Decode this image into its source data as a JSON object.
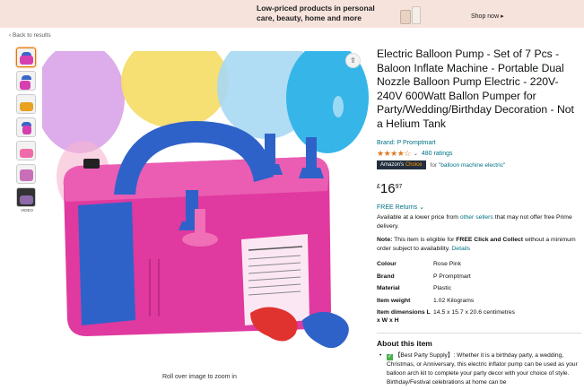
{
  "banner": {
    "text": "Low-priced products in personal care, beauty, home and more",
    "shop_now": "Shop now ▸"
  },
  "nav": {
    "back": "‹ Back to results"
  },
  "gallery": {
    "thumbnails": [
      "image-1",
      "image-2",
      "image-3",
      "image-4",
      "image-5",
      "image-6",
      "video"
    ],
    "video_label": "VIDEO",
    "rollover": "Roll over image to zoom in"
  },
  "product": {
    "title": "Electric Balloon Pump - Set of 7 Pcs - Baloon Inflate Machine - Portable Dual Nozzle Balloon Pump Electric - 220V-240V 600Watt Ballon Pumper for Party/Wedding/Birthday Decoration - Not a Helium Tank",
    "brand": "Brand: P Promptmart",
    "stars": "★★★★☆",
    "rating_value": 4.3,
    "ratings_count": "480 ratings",
    "choice_badge_main": "Amazon's",
    "choice_badge_accent": "Choice",
    "choice_for": "for",
    "choice_keyword": "\"balloon machine electric\"",
    "price_currency": "£",
    "price_whole": "16",
    "price_fraction": "97",
    "returns": "FREE Returns ⌄",
    "availability_pre": "Available at a lower price from ",
    "availability_link": "other sellers",
    "availability_post": " that may not offer free Prime delivery.",
    "note_label": "Note:",
    "note_pre": " This item is eligible for ",
    "note_bold": "FREE Click and Collect",
    "note_post": " without a minimum order subject to availability. ",
    "note_link": "Details",
    "specs": [
      {
        "key": "Colour",
        "value": "Rose Pink"
      },
      {
        "key": "Brand",
        "value": "P Promptmart"
      },
      {
        "key": "Material",
        "value": "Plastic"
      },
      {
        "key": "Item weight",
        "value": "1.02 Kilograms"
      },
      {
        "key": "Item dimensions L x W x H",
        "value": "14.5 x 15.7 x 20.6 centimetres"
      }
    ],
    "about_heading": "About this item",
    "about_bullet": "【Best Party Supply】: Whether it is a birthday party, a wedding, Christmas, or Anniversary, this electric inflator pump can be used as your balloon arch kit to complete your party decor with your choice of style. Birthday/Festival celebrations at home can be"
  },
  "colors": {
    "link": "#007185",
    "star": "#de7921",
    "pump_pink": "#e0399f",
    "pump_blue": "#2f62c9"
  }
}
